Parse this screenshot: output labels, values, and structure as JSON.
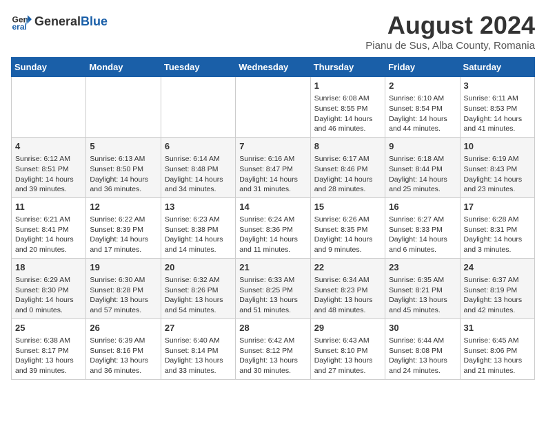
{
  "logo": {
    "text_general": "General",
    "text_blue": "Blue"
  },
  "header": {
    "month_year": "August 2024",
    "location": "Pianu de Sus, Alba County, Romania"
  },
  "days_of_week": [
    "Sunday",
    "Monday",
    "Tuesday",
    "Wednesday",
    "Thursday",
    "Friday",
    "Saturday"
  ],
  "weeks": [
    [
      {
        "day": "",
        "sunrise": "",
        "sunset": "",
        "daylight": ""
      },
      {
        "day": "",
        "sunrise": "",
        "sunset": "",
        "daylight": ""
      },
      {
        "day": "",
        "sunrise": "",
        "sunset": "",
        "daylight": ""
      },
      {
        "day": "",
        "sunrise": "",
        "sunset": "",
        "daylight": ""
      },
      {
        "day": "1",
        "sunrise": "Sunrise: 6:08 AM",
        "sunset": "Sunset: 8:55 PM",
        "daylight": "Daylight: 14 hours and 46 minutes."
      },
      {
        "day": "2",
        "sunrise": "Sunrise: 6:10 AM",
        "sunset": "Sunset: 8:54 PM",
        "daylight": "Daylight: 14 hours and 44 minutes."
      },
      {
        "day": "3",
        "sunrise": "Sunrise: 6:11 AM",
        "sunset": "Sunset: 8:53 PM",
        "daylight": "Daylight: 14 hours and 41 minutes."
      }
    ],
    [
      {
        "day": "4",
        "sunrise": "Sunrise: 6:12 AM",
        "sunset": "Sunset: 8:51 PM",
        "daylight": "Daylight: 14 hours and 39 minutes."
      },
      {
        "day": "5",
        "sunrise": "Sunrise: 6:13 AM",
        "sunset": "Sunset: 8:50 PM",
        "daylight": "Daylight: 14 hours and 36 minutes."
      },
      {
        "day": "6",
        "sunrise": "Sunrise: 6:14 AM",
        "sunset": "Sunset: 8:48 PM",
        "daylight": "Daylight: 14 hours and 34 minutes."
      },
      {
        "day": "7",
        "sunrise": "Sunrise: 6:16 AM",
        "sunset": "Sunset: 8:47 PM",
        "daylight": "Daylight: 14 hours and 31 minutes."
      },
      {
        "day": "8",
        "sunrise": "Sunrise: 6:17 AM",
        "sunset": "Sunset: 8:46 PM",
        "daylight": "Daylight: 14 hours and 28 minutes."
      },
      {
        "day": "9",
        "sunrise": "Sunrise: 6:18 AM",
        "sunset": "Sunset: 8:44 PM",
        "daylight": "Daylight: 14 hours and 25 minutes."
      },
      {
        "day": "10",
        "sunrise": "Sunrise: 6:19 AM",
        "sunset": "Sunset: 8:43 PM",
        "daylight": "Daylight: 14 hours and 23 minutes."
      }
    ],
    [
      {
        "day": "11",
        "sunrise": "Sunrise: 6:21 AM",
        "sunset": "Sunset: 8:41 PM",
        "daylight": "Daylight: 14 hours and 20 minutes."
      },
      {
        "day": "12",
        "sunrise": "Sunrise: 6:22 AM",
        "sunset": "Sunset: 8:39 PM",
        "daylight": "Daylight: 14 hours and 17 minutes."
      },
      {
        "day": "13",
        "sunrise": "Sunrise: 6:23 AM",
        "sunset": "Sunset: 8:38 PM",
        "daylight": "Daylight: 14 hours and 14 minutes."
      },
      {
        "day": "14",
        "sunrise": "Sunrise: 6:24 AM",
        "sunset": "Sunset: 8:36 PM",
        "daylight": "Daylight: 14 hours and 11 minutes."
      },
      {
        "day": "15",
        "sunrise": "Sunrise: 6:26 AM",
        "sunset": "Sunset: 8:35 PM",
        "daylight": "Daylight: 14 hours and 9 minutes."
      },
      {
        "day": "16",
        "sunrise": "Sunrise: 6:27 AM",
        "sunset": "Sunset: 8:33 PM",
        "daylight": "Daylight: 14 hours and 6 minutes."
      },
      {
        "day": "17",
        "sunrise": "Sunrise: 6:28 AM",
        "sunset": "Sunset: 8:31 PM",
        "daylight": "Daylight: 14 hours and 3 minutes."
      }
    ],
    [
      {
        "day": "18",
        "sunrise": "Sunrise: 6:29 AM",
        "sunset": "Sunset: 8:30 PM",
        "daylight": "Daylight: 14 hours and 0 minutes."
      },
      {
        "day": "19",
        "sunrise": "Sunrise: 6:30 AM",
        "sunset": "Sunset: 8:28 PM",
        "daylight": "Daylight: 13 hours and 57 minutes."
      },
      {
        "day": "20",
        "sunrise": "Sunrise: 6:32 AM",
        "sunset": "Sunset: 8:26 PM",
        "daylight": "Daylight: 13 hours and 54 minutes."
      },
      {
        "day": "21",
        "sunrise": "Sunrise: 6:33 AM",
        "sunset": "Sunset: 8:25 PM",
        "daylight": "Daylight: 13 hours and 51 minutes."
      },
      {
        "day": "22",
        "sunrise": "Sunrise: 6:34 AM",
        "sunset": "Sunset: 8:23 PM",
        "daylight": "Daylight: 13 hours and 48 minutes."
      },
      {
        "day": "23",
        "sunrise": "Sunrise: 6:35 AM",
        "sunset": "Sunset: 8:21 PM",
        "daylight": "Daylight: 13 hours and 45 minutes."
      },
      {
        "day": "24",
        "sunrise": "Sunrise: 6:37 AM",
        "sunset": "Sunset: 8:19 PM",
        "daylight": "Daylight: 13 hours and 42 minutes."
      }
    ],
    [
      {
        "day": "25",
        "sunrise": "Sunrise: 6:38 AM",
        "sunset": "Sunset: 8:17 PM",
        "daylight": "Daylight: 13 hours and 39 minutes."
      },
      {
        "day": "26",
        "sunrise": "Sunrise: 6:39 AM",
        "sunset": "Sunset: 8:16 PM",
        "daylight": "Daylight: 13 hours and 36 minutes."
      },
      {
        "day": "27",
        "sunrise": "Sunrise: 6:40 AM",
        "sunset": "Sunset: 8:14 PM",
        "daylight": "Daylight: 13 hours and 33 minutes."
      },
      {
        "day": "28",
        "sunrise": "Sunrise: 6:42 AM",
        "sunset": "Sunset: 8:12 PM",
        "daylight": "Daylight: 13 hours and 30 minutes."
      },
      {
        "day": "29",
        "sunrise": "Sunrise: 6:43 AM",
        "sunset": "Sunset: 8:10 PM",
        "daylight": "Daylight: 13 hours and 27 minutes."
      },
      {
        "day": "30",
        "sunrise": "Sunrise: 6:44 AM",
        "sunset": "Sunset: 8:08 PM",
        "daylight": "Daylight: 13 hours and 24 minutes."
      },
      {
        "day": "31",
        "sunrise": "Sunrise: 6:45 AM",
        "sunset": "Sunset: 8:06 PM",
        "daylight": "Daylight: 13 hours and 21 minutes."
      }
    ]
  ]
}
